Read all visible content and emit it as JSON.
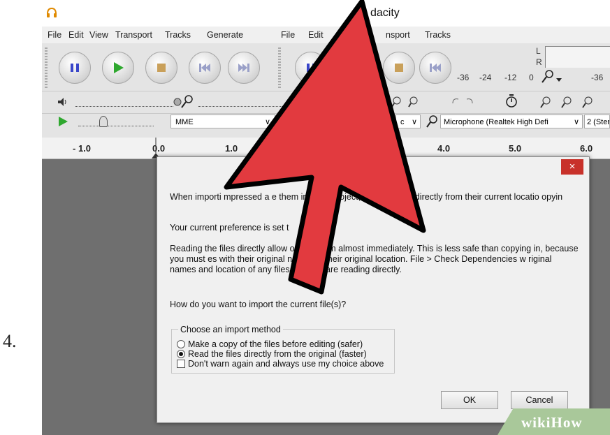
{
  "step_number": "4.",
  "window": {
    "title_fragment": "dacity"
  },
  "menu_left": [
    "File",
    "Edit",
    "View",
    "Transport",
    "Tracks",
    "Generate"
  ],
  "menu_right": [
    "File",
    "Edit",
    "nsport",
    "Tracks"
  ],
  "meter": {
    "L": "L",
    "R": "R",
    "ticks": [
      "-36",
      "-24",
      "-12",
      "0",
      "-36"
    ]
  },
  "device_toolbar": {
    "host": "MME",
    "output_fragment": "c",
    "input": "Microphone (Realtek High Defi",
    "channels": "2 (Ster"
  },
  "ruler_ticks": [
    "- 1.0",
    "0.0",
    "1.0",
    "4.0",
    "5.0",
    "6.0"
  ],
  "dialog": {
    "close_label": "×",
    "para1": "When importi      mpressed a                              e them into the project, or read them directly from their current locatio           opyin",
    "para2": "Your current preference is set t",
    "para3": "Reading the files directly allow              or edit them almost immediately.  This is less safe than copying in, because you must          es with their original names in their original location. File > Check Dependencies w           riginal names and location of any files that you are reading directly.",
    "question": "How do you want to import the current file(s)?",
    "group_label": "Choose an import method",
    "option_copy": "Make a copy of the files before editing (safer)",
    "option_read": "Read the files directly from the original (faster)",
    "option_dont_warn": "Don't warn again and always use my choice above",
    "selected_option": "option_read",
    "ok_label": "OK",
    "cancel_label": "Cancel"
  },
  "watermark": "wikiHow",
  "colors": {
    "arrow_fill": "#e23a3f",
    "arrow_stroke": "#000000",
    "close_button": "#c8312a",
    "watermark_bg": "#a9c89a"
  }
}
